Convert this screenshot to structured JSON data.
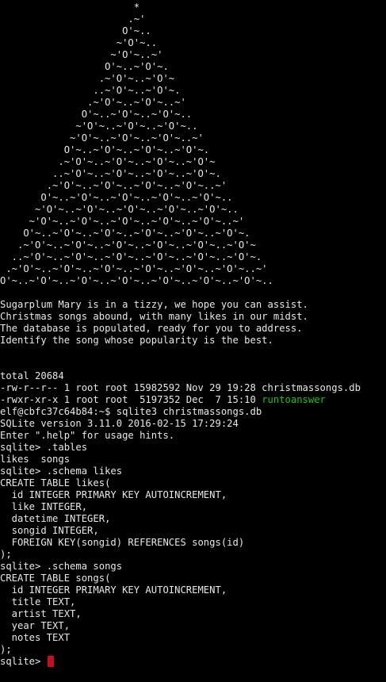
{
  "colors": {
    "background": "#000000",
    "text": "#e8e8e8",
    "executable": "#16c60c",
    "cursor": "#c50f1f"
  },
  "tree": [
    "                       *",
    "                      .~'",
    "                     O'~..",
    "                    ~'O'~..",
    "                   ~'O'~..~'",
    "                  O'~..~'O'~.",
    "                 .~'O'~..~'O'~",
    "                ..~'O'~..~'O'~.",
    "               .~'O'~..~'O'~..~'",
    "              O'~..~'O'~..~'O'~..",
    "             ~'O'~..~'O'~..~'O'~..",
    "            ~'O'~..~'O'~..~'O'~..~'",
    "           O'~..~'O'~..~'O'~..~'O'~.",
    "          .~'O'~..~'O'~..~'O'~..~'O'~",
    "         ..~'O'~..~'O'~..~'O'~..~'O'~.",
    "        .~'O'~..~'O'~..~'O'~..~'O'~..~'",
    "       O'~..~'O'~..~'O'~..~'O'~..~'O'~..",
    "      ~'O'~..~'O'~..~'O'~..~'O'~..~'O'~..",
    "     ~'O'~..~'O'~..~'O'~..~'O'~..~'O'~..~'",
    "    O'~..~'O'~..~'O'~..~'O'~..~'O'~..~'O'~.",
    "   .~'O'~..~'O'~..~'O'~..~'O'~..~'O'~..~'O'~",
    "  ..~'O'~..~'O'~..~'O'~..~'O'~..~'O'~..~'O'~.",
    " .~'O'~..~'O'~..~'O'~..~'O'~..~'O'~..~'O'~..~'",
    "O'~..~'O'~..~'O'~..~'O'~..~'O'~..~'O'~..~'O'~.."
  ],
  "poem": [
    "Sugarplum Mary is in a tizzy, we hope you can assist.",
    "Christmas songs abound, with many likes in our midst.",
    "The database is populated, ready for you to address.",
    "Identify the song whose popularity is the best."
  ],
  "listing": {
    "total": "total 20684",
    "file1": "-rw-r--r-- 1 root root 15982592 Nov 29 19:28 christmassongs.db",
    "file2_meta": "-rwxr-xr-x 1 root root  5197352 Dec  7 15:10 ",
    "file2_name": "runtoanswer"
  },
  "session": [
    "elf@cbfc37c64b84:~$ sqlite3 christmassongs.db",
    "SQLite version 3.11.0 2016-02-15 17:29:24",
    "Enter \".help\" for usage hints.",
    "sqlite> .tables",
    "likes  songs",
    "sqlite> .schema likes",
    "CREATE TABLE likes(",
    "  id INTEGER PRIMARY KEY AUTOINCREMENT,",
    "  like INTEGER,",
    "  datetime INTEGER,",
    "  songid INTEGER,",
    "  FOREIGN KEY(songid) REFERENCES songs(id)",
    ");",
    "sqlite> .schema songs",
    "CREATE TABLE songs(",
    "  id INTEGER PRIMARY KEY AUTOINCREMENT,",
    "  title TEXT,",
    "  artist TEXT,",
    "  year TEXT,",
    "  notes TEXT",
    ");"
  ],
  "prompt": {
    "text": "sqlite> ",
    "input": ""
  }
}
